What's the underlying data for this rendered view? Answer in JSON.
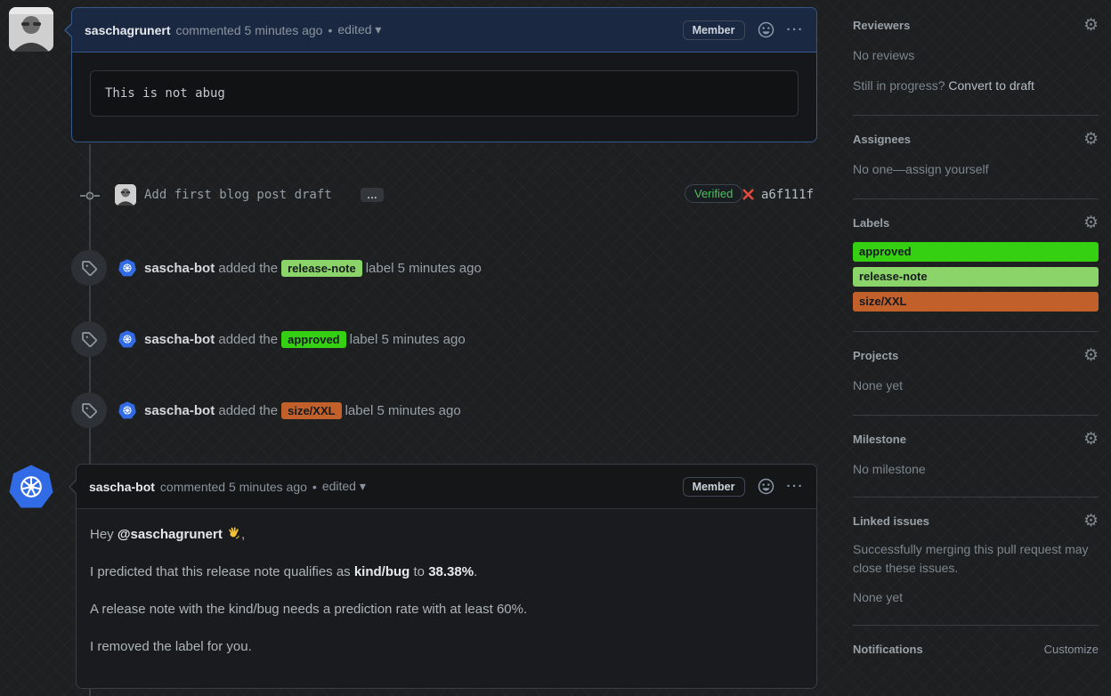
{
  "glyphs": {
    "gear": "⚙",
    "dot": "•",
    "caret_down": "▾",
    "kebab": "···",
    "ellipsis": "…"
  },
  "comment1": {
    "author": "saschagrunert",
    "meta": "commented 5 minutes ago",
    "edited": "edited",
    "member_badge": "Member",
    "body_code": "This is not abug"
  },
  "commit": {
    "message": "Add first blog post draft",
    "verified": "Verified",
    "sha": "a6f111f"
  },
  "events": [
    {
      "actor": "sascha-bot",
      "action": "added the",
      "label": "release-note",
      "label_bg": "#8bd46a",
      "suffix": "label 5 minutes ago"
    },
    {
      "actor": "sascha-bot",
      "action": "added the",
      "label": "approved",
      "label_bg": "#35d011",
      "suffix": "label 5 minutes ago"
    },
    {
      "actor": "sascha-bot",
      "action": "added the",
      "label": "size/XXL",
      "label_bg": "#c2602c",
      "suffix": "label 5 minutes ago"
    }
  ],
  "comment2": {
    "author": "sascha-bot",
    "meta": "commented 5 minutes ago",
    "edited": "edited",
    "member_badge": "Member",
    "p1_prefix": "Hey ",
    "p1_mention": "@saschagrunert",
    "p1_suffix": ",",
    "p2_prefix": "I predicted that this release note qualifies as ",
    "p2_bold1": "kind/bug",
    "p2_mid": " to ",
    "p2_bold2": "38.38%",
    "p2_suffix": ".",
    "p3": "A release note with the kind/bug needs a prediction rate with at least 60%.",
    "p4": "I removed the label for you."
  },
  "sidebar": {
    "reviewers": {
      "title": "Reviewers",
      "empty": "No reviews",
      "draft_prefix": "Still in progress? ",
      "draft_link": "Convert to draft"
    },
    "assignees": {
      "title": "Assignees",
      "empty_prefix": "No one—",
      "assign_link": "assign yourself"
    },
    "labels": {
      "title": "Labels",
      "items": [
        {
          "name": "approved",
          "bg": "#35d011"
        },
        {
          "name": "release-note",
          "bg": "#8bd46a"
        },
        {
          "name": "size/XXL",
          "bg": "#c2602c"
        }
      ]
    },
    "projects": {
      "title": "Projects",
      "empty": "None yet"
    },
    "milestone": {
      "title": "Milestone",
      "empty": "No milestone"
    },
    "linked_issues": {
      "title": "Linked issues",
      "desc": "Successfully merging this pull request may close these issues.",
      "empty": "None yet"
    },
    "notifications": {
      "title": "Notifications",
      "customize": "Customize"
    }
  }
}
